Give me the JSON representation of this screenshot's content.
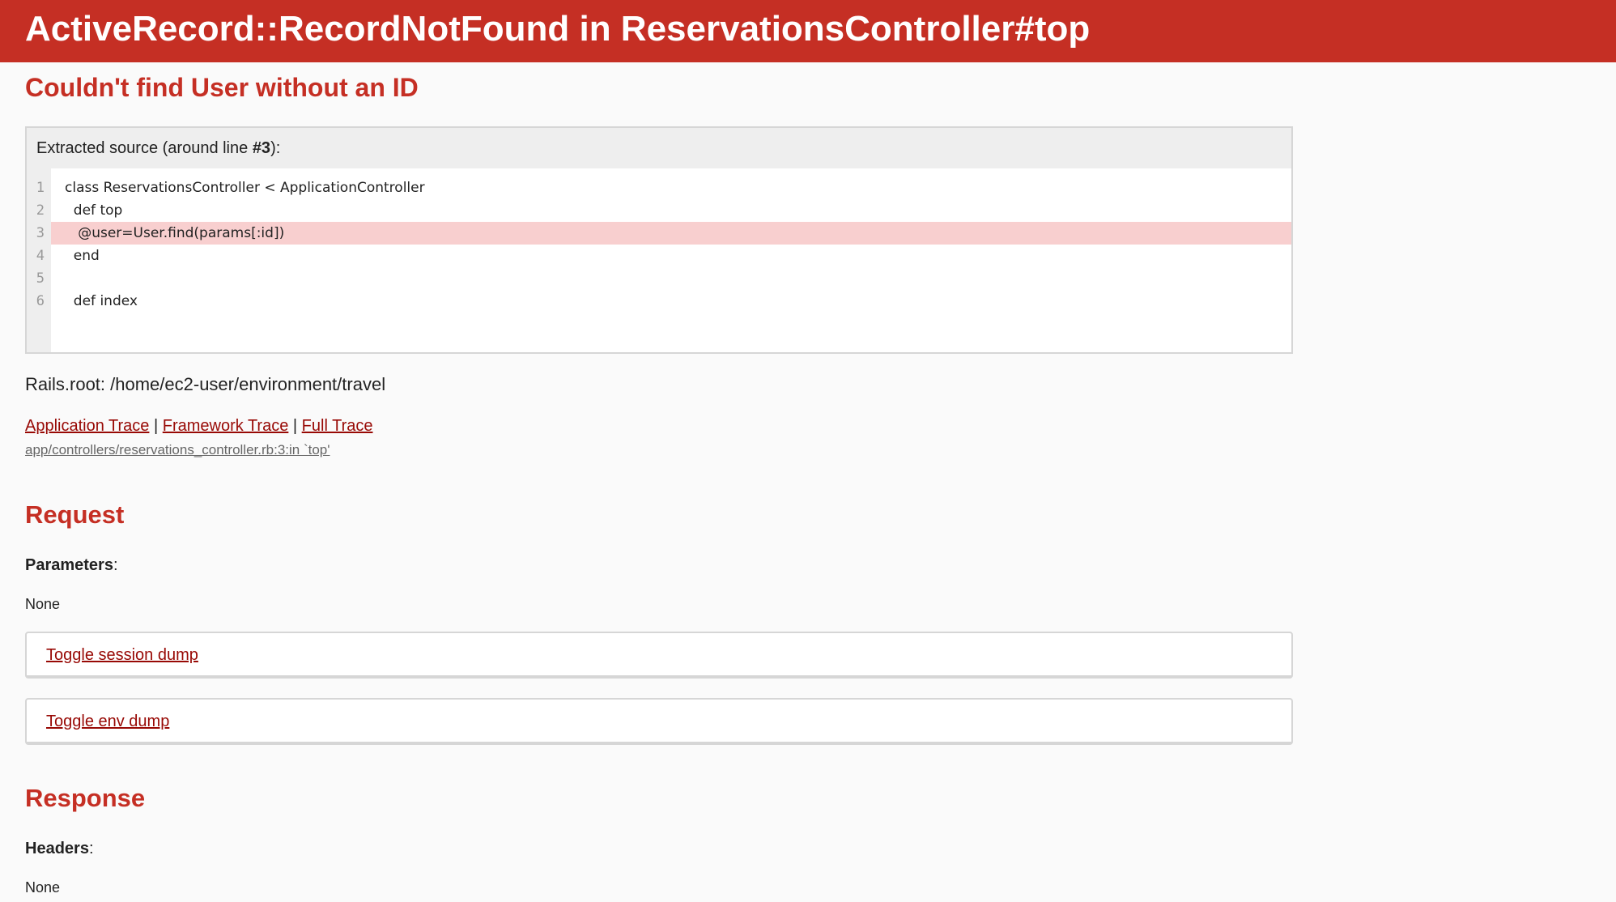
{
  "header": {
    "title": "ActiveRecord::RecordNotFound in ReservationsController#top"
  },
  "exception_message": "Couldn't find User without an ID",
  "source": {
    "title_prefix": "Extracted source (around line ",
    "title_line": "#3",
    "title_suffix": "):",
    "lines": [
      {
        "num": "1",
        "code": "class ReservationsController < ApplicationController"
      },
      {
        "num": "2",
        "code": "  def top"
      },
      {
        "num": "3",
        "code": "   @user=User.find(params[:id])"
      },
      {
        "num": "4",
        "code": "  end"
      },
      {
        "num": "5",
        "code": ""
      },
      {
        "num": "6",
        "code": "  def index"
      }
    ],
    "highlight_line": "3"
  },
  "rails_root": "Rails.root: /home/ec2-user/environment/travel",
  "traces": {
    "application": "Application Trace",
    "framework": "Framework Trace",
    "full": "Full Trace",
    "separator": "|",
    "entry": "app/controllers/reservations_controller.rb:3:in `top'"
  },
  "request": {
    "heading": "Request",
    "parameters_label": "Parameters",
    "parameters_value": "None",
    "toggle_session": "Toggle session dump",
    "toggle_env": "Toggle env dump"
  },
  "response": {
    "heading": "Response",
    "headers_label": "Headers",
    "headers_value": "None"
  },
  "colors": {
    "header_bg": "#c52f24",
    "heading_red": "#c52f24",
    "link_red": "#980905",
    "highlight": "#f8cfcf"
  }
}
